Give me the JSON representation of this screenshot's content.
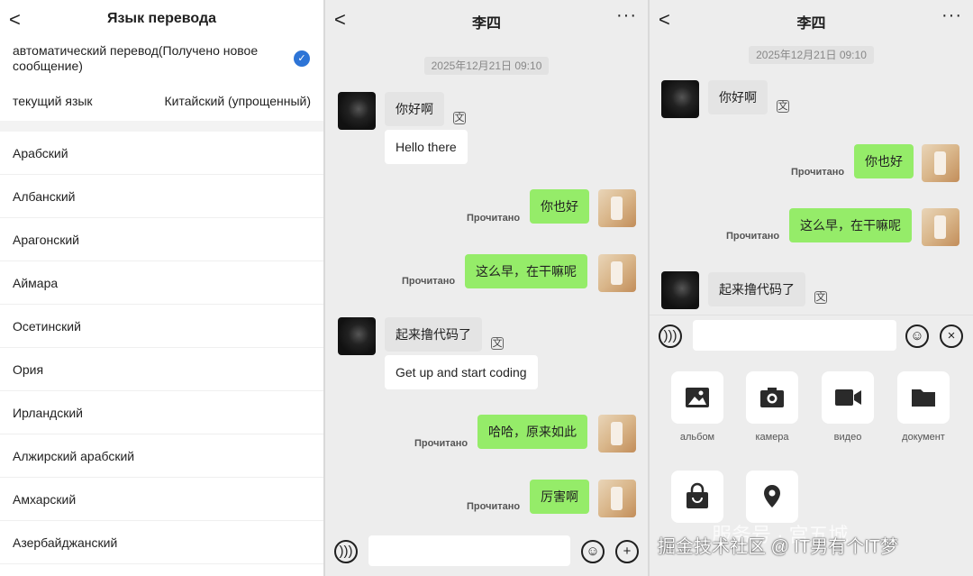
{
  "settings": {
    "title": "Язык перевода",
    "back_glyph": "<",
    "auto_translate": "автоматический перевод(Получено новое сообщение)",
    "current_language_label": "текущий язык",
    "current_language_value": "Китайский (упрощенный)",
    "languages": [
      "Арабский",
      "Албанский",
      "Арагонский",
      "Аймара",
      "Осетинский",
      "Ория",
      "Ирландский",
      "Алжирский арабский",
      "Амхарский",
      "Азербайджанский"
    ]
  },
  "chat": {
    "contact_name": "李四",
    "timestamp": "2025年12月21日 09:10",
    "read_status": "Прочитано",
    "more_glyph": "···",
    "messages": {
      "m1": "你好啊",
      "m1_translation": "Hello there",
      "m2": "你也好",
      "m3": "这么早，在干嘛呢",
      "m4": "起来撸代码了",
      "m4_translation": "Get up and start coding",
      "m5": "哈哈，原来如此",
      "m6": "厉害啊"
    }
  },
  "attach_panel": {
    "items": [
      "альбом",
      "камера",
      "видео",
      "документ"
    ]
  },
  "watermark": {
    "main": "掘金技术社区 @ IT男有个IT梦",
    "behind": "服务号 · 宫五城"
  },
  "colors": {
    "sent_bubble": "#95ec69",
    "received_bubble": "#e4e4e4",
    "check_blue": "#2d74d6",
    "chat_bg": "#ededed"
  }
}
